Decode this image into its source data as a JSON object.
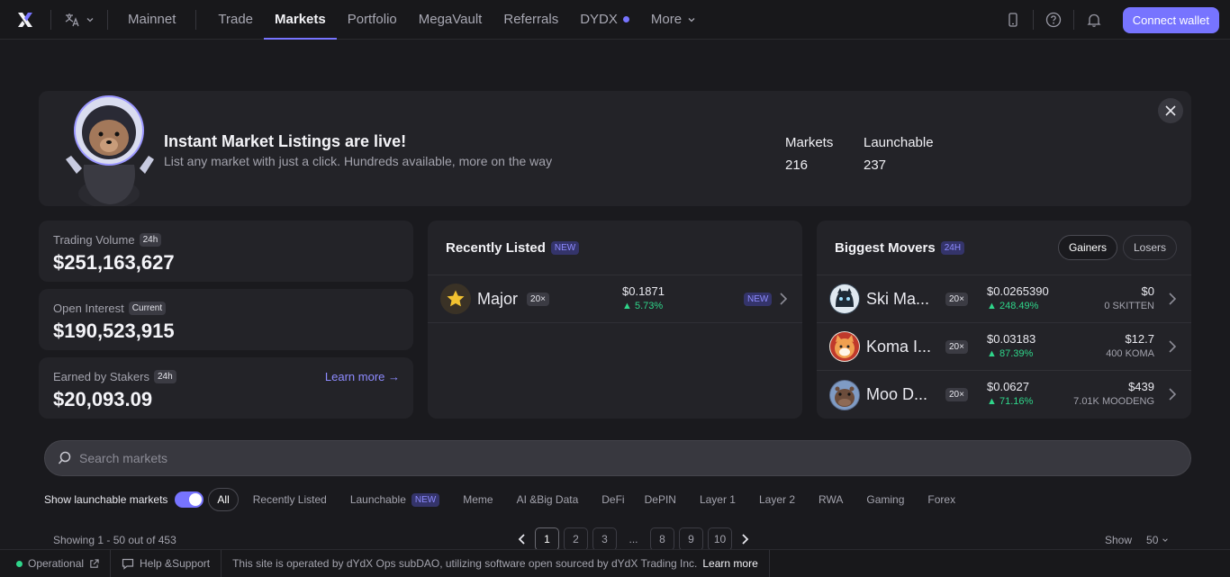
{
  "nav": {
    "network": "Mainnet",
    "links": [
      "Trade",
      "Markets",
      "Portfolio",
      "MegaVault",
      "Referrals",
      "DYDX",
      "More"
    ],
    "active": "Markets",
    "connect": "Connect wallet"
  },
  "banner": {
    "title": "Instant Market Listings are live!",
    "subtitle": "List any market with just a click. Hundreds available, more on the way",
    "markets_label": "Markets",
    "markets_value": "216",
    "launchable_label": "Launchable",
    "launchable_value": "237"
  },
  "stats": {
    "volume": {
      "label": "Trading Volume",
      "tag": "24h",
      "value": "$251,163,627"
    },
    "oi": {
      "label": "Open Interest",
      "tag": "Current",
      "value": "$190,523,915"
    },
    "stakers": {
      "label": "Earned by Stakers",
      "tag": "24h",
      "value": "$20,093.09",
      "link": "Learn more →"
    }
  },
  "recent": {
    "title": "Recently Listed",
    "tag": "NEW",
    "rows": [
      {
        "name": "Major",
        "lev": "20×",
        "price": "$0.1871",
        "change": "5.73%",
        "tag": "NEW"
      }
    ]
  },
  "movers": {
    "title": "Biggest Movers",
    "tag": "24H",
    "gainers": "Gainers",
    "losers": "Losers",
    "rows": [
      {
        "name": "Ski Ma...",
        "lev": "20×",
        "price": "$0.0265390",
        "change": "248.49%",
        "usd": "$0",
        "amount": "0 SKITTEN"
      },
      {
        "name": "Koma I...",
        "lev": "20×",
        "price": "$0.03183",
        "change": "87.39%",
        "usd": "$12.7",
        "amount": "400 KOMA"
      },
      {
        "name": "Moo D...",
        "lev": "20×",
        "price": "$0.0627",
        "change": "71.16%",
        "usd": "$439",
        "amount": "7.01K MOODENG"
      }
    ]
  },
  "search": {
    "placeholder": "Search markets"
  },
  "filters": {
    "toggle_label": "Show launchable markets",
    "chips": [
      "All",
      "Recently Listed",
      "Launchable",
      "Meme",
      "AI &Big Data",
      "DeFi",
      "DePIN",
      "Layer 1",
      "Layer 2",
      "RWA",
      "Gaming",
      "Forex"
    ],
    "launchable_tag": "NEW"
  },
  "pager": {
    "showing": "Showing 1 - 50 out of 453",
    "pages": [
      "1",
      "2",
      "3",
      "...",
      "8",
      "9",
      "10"
    ],
    "show_label": "Show",
    "show_value": "50"
  },
  "footer": {
    "status": "Operational",
    "help": "Help &Support",
    "notice": "This site is operated by dYdX Ops subDAO, utilizing software open sourced by dYdX Trading Inc.",
    "learn": "Learn more"
  },
  "colors": {
    "accent": "#7774ff",
    "positive": "#2fd58a"
  }
}
